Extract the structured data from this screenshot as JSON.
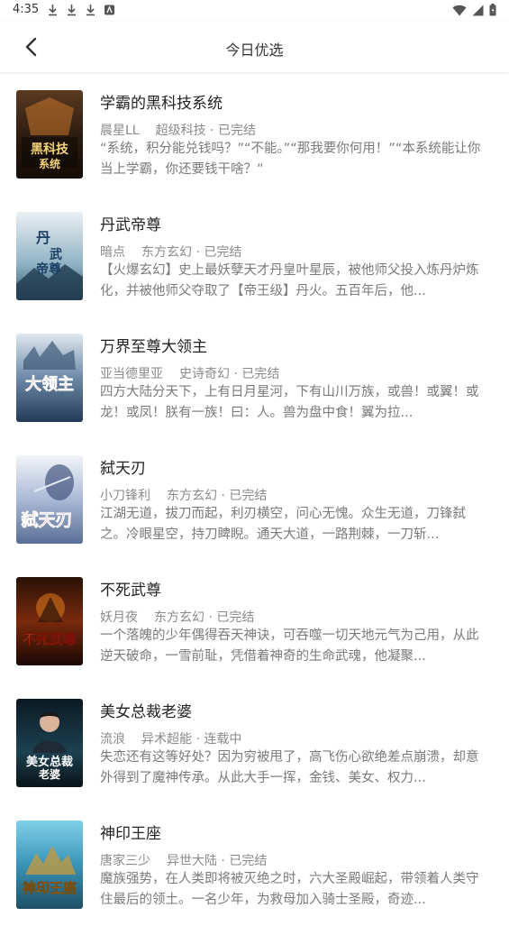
{
  "status_bar": {
    "time": "4:35"
  },
  "header": {
    "title": "今日优选"
  },
  "books": [
    {
      "title": "学霸的黑科技系统",
      "author": "晨星LL",
      "category": "超级科技",
      "status": "已完结",
      "description": "“系统，积分能兑钱吗？”“不能。”“那我要你何用！”“本系统能让你当上学霸，你还要钱干啥？”",
      "cover_text": "学霸的黑科技系统"
    },
    {
      "title": "丹武帝尊",
      "author": "暗点",
      "category": "东方玄幻",
      "status": "已完结",
      "description": "【火爆玄幻】史上最妖孽天才丹皇叶星辰，被他师父投入炼丹炉炼化，并被他师父夺取了【帝王级】丹火。五百年后，他...",
      "cover_text": "丹武帝尊"
    },
    {
      "title": "万界至尊大领主",
      "author": "亚当德里亚",
      "category": "史诗奇幻",
      "status": "已完结",
      "description": "四方大陆分天下，上有日月星河，下有山川万族，或兽！或翼！或龙！或凤！朕有一族！曰：人。兽为盘中食！翼为拉...",
      "cover_text": "大领主"
    },
    {
      "title": "弑天刃",
      "author": "小刀锋利",
      "category": "东方玄幻",
      "status": "已完结",
      "description": "江湖无道，拔刀而起，利刃横空，问心无愧。众生无道，刀锋弑之。冷眼星空，持刀睥睨。通天大道，一路荆棘，一刀斩...",
      "cover_text": "弑天刃"
    },
    {
      "title": "不死武尊",
      "author": "妖月夜",
      "category": "东方玄幻",
      "status": "已完结",
      "description": "一个落魄的少年偶得吞天神诀，可吞噬一切天地元气为己用，从此逆天破命，一雪前耻，凭借着神奇的生命武魂，他凝聚...",
      "cover_text": "不死武尊"
    },
    {
      "title": "美女总裁老婆",
      "author": "流浪",
      "category": "异术超能",
      "status": "连载中",
      "description": "失恋还有这等好处？因为穷被甩了，高飞伤心欲绝差点崩溃，却意外得到了魔神传承。从此大手一挥，金钱、美女、权力...",
      "cover_text": "美女总裁老婆"
    },
    {
      "title": "神印王座",
      "author": "唐家三少",
      "category": "异世大陆",
      "status": "已完结",
      "description": "魔族强势，在人类即将被灭绝之时，六大圣殿崛起，带领着人类守住最后的领土。一名少年，为救母加入骑士圣殿，奇迹...",
      "cover_text": "神印王座"
    }
  ],
  "colors": {
    "title_text": "#222222",
    "meta_text": "#8a8a8a",
    "desc_text": "#7a7a7a"
  }
}
